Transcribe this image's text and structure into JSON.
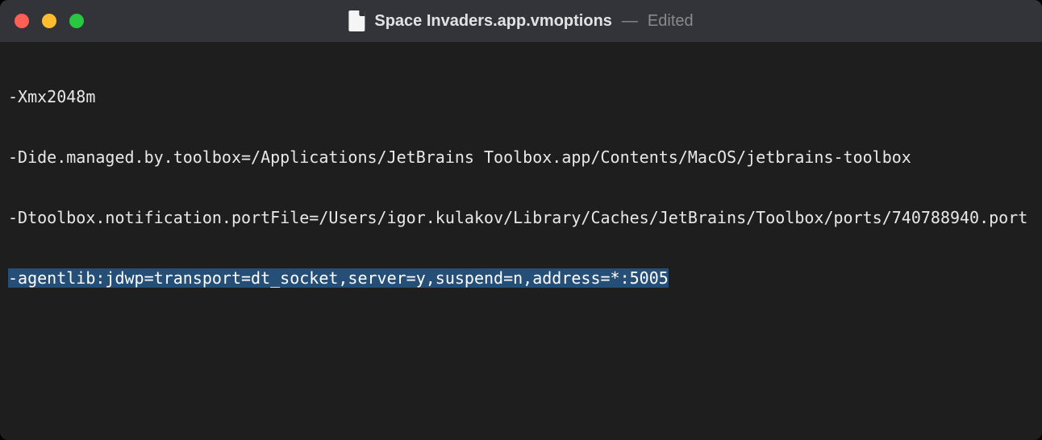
{
  "titlebar": {
    "filename": "Space Invaders.app.vmoptions",
    "separator": "—",
    "status": "Edited"
  },
  "editor": {
    "lines": [
      "-Xmx2048m",
      "-Dide.managed.by.toolbox=/Applications/JetBrains Toolbox.app/Contents/MacOS/jetbrains-toolbox",
      "-Dtoolbox.notification.portFile=/Users/igor.kulakov/Library/Caches/JetBrains/Toolbox/ports/740788940.port"
    ],
    "selected_line": "-agentlib:jdwp=transport=dt_socket,server=y,suspend=n,address=*:5005"
  }
}
